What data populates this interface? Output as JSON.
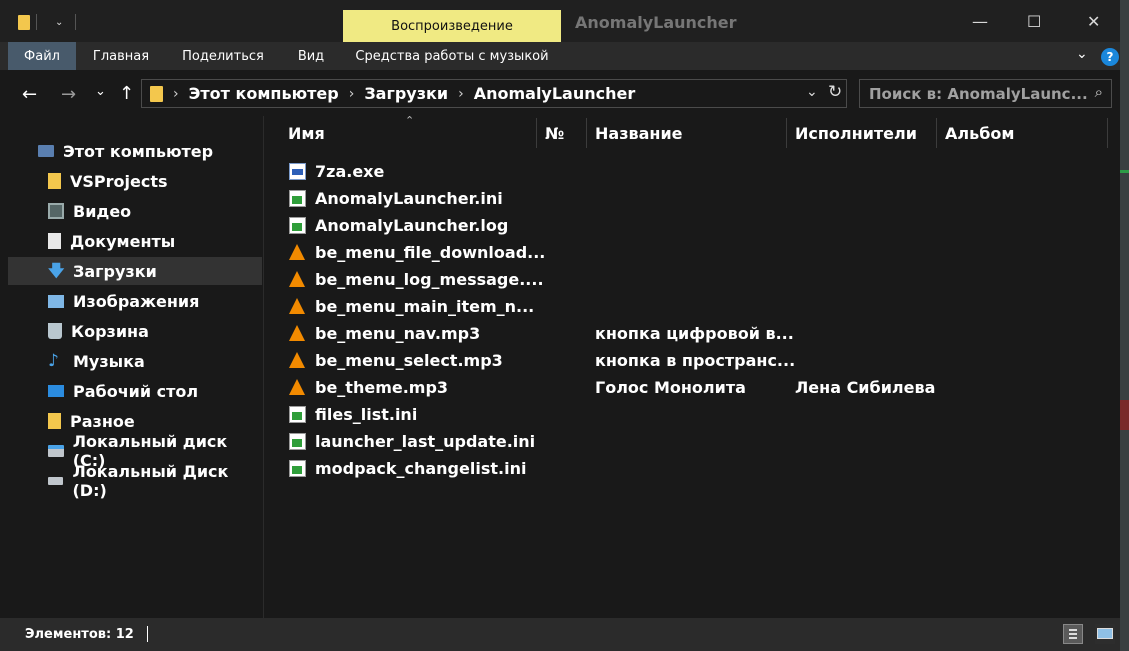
{
  "titlebar": {
    "context_tab": "Воспроизведение",
    "app_title": "AnomalyLauncher",
    "minimize": "—",
    "maximize": "☐",
    "close": "✕"
  },
  "ribbon": {
    "tabs": [
      "Файл",
      "Главная",
      "Поделиться",
      "Вид",
      "Средства работы с музыкой"
    ],
    "help": "?",
    "expand": "⌄"
  },
  "nav": {
    "back": "←",
    "forward": "→",
    "recent": "⌄",
    "up": "↑"
  },
  "address": {
    "crumbs": [
      "Этот компьютер",
      "Загрузки",
      "AnomalyLauncher"
    ],
    "dropdown": "⌄",
    "refresh": "↻"
  },
  "search": {
    "placeholder": "Поиск в: AnomalyLaunc...",
    "icon": "⌕"
  },
  "sidebar": {
    "items": [
      {
        "label": "Этот компьютер",
        "icon": "computer-icon"
      },
      {
        "label": "VSProjects",
        "icon": "folder-icon"
      },
      {
        "label": "Видео",
        "icon": "video-icon"
      },
      {
        "label": "Документы",
        "icon": "documents-icon"
      },
      {
        "label": "Загрузки",
        "icon": "downloads-icon"
      },
      {
        "label": "Изображения",
        "icon": "pictures-icon"
      },
      {
        "label": "Корзина",
        "icon": "recycle-bin-icon"
      },
      {
        "label": "Музыка",
        "icon": "music-icon"
      },
      {
        "label": "Рабочий стол",
        "icon": "desktop-icon"
      },
      {
        "label": "Разное",
        "icon": "folder-icon"
      },
      {
        "label": "Локальный диск (C:)",
        "icon": "drive-c-icon"
      },
      {
        "label": "Локальный Диск (D:)",
        "icon": "drive-d-icon"
      }
    ],
    "selected": "Загрузки"
  },
  "columns": {
    "name": "Имя",
    "number": "№",
    "title": "Название",
    "artists": "Исполнители",
    "album": "Альбом"
  },
  "files": [
    {
      "name": "7za.exe",
      "type": "exe",
      "title": "",
      "artist": ""
    },
    {
      "name": "AnomalyLauncher.ini",
      "type": "ini",
      "title": "",
      "artist": ""
    },
    {
      "name": "AnomalyLauncher.log",
      "type": "ini",
      "title": "",
      "artist": ""
    },
    {
      "name": "be_menu_file_download...",
      "type": "vlc",
      "title": "",
      "artist": ""
    },
    {
      "name": "be_menu_log_message....",
      "type": "vlc",
      "title": "",
      "artist": ""
    },
    {
      "name": "be_menu_main_item_n...",
      "type": "vlc",
      "title": "",
      "artist": ""
    },
    {
      "name": "be_menu_nav.mp3",
      "type": "vlc",
      "title": "кнопка цифровой в...",
      "artist": ""
    },
    {
      "name": "be_menu_select.mp3",
      "type": "vlc",
      "title": "кнопка в пространс...",
      "artist": ""
    },
    {
      "name": "be_theme.mp3",
      "type": "vlc",
      "title": "Голос Монолита",
      "artist": "Лена Сибилева"
    },
    {
      "name": "files_list.ini",
      "type": "ini",
      "title": "",
      "artist": ""
    },
    {
      "name": "launcher_last_update.ini",
      "type": "ini",
      "title": "",
      "artist": ""
    },
    {
      "name": "modpack_changelist.ini",
      "type": "ini",
      "title": "",
      "artist": ""
    }
  ],
  "status": {
    "count": "Элементов: 12"
  },
  "colors": {
    "window_bg": "#191919",
    "ribbon_bg": "#2b2b2b",
    "active_tab": "#485a6b",
    "context_tab": "#f0ea83",
    "help_blue": "#1a87db"
  }
}
